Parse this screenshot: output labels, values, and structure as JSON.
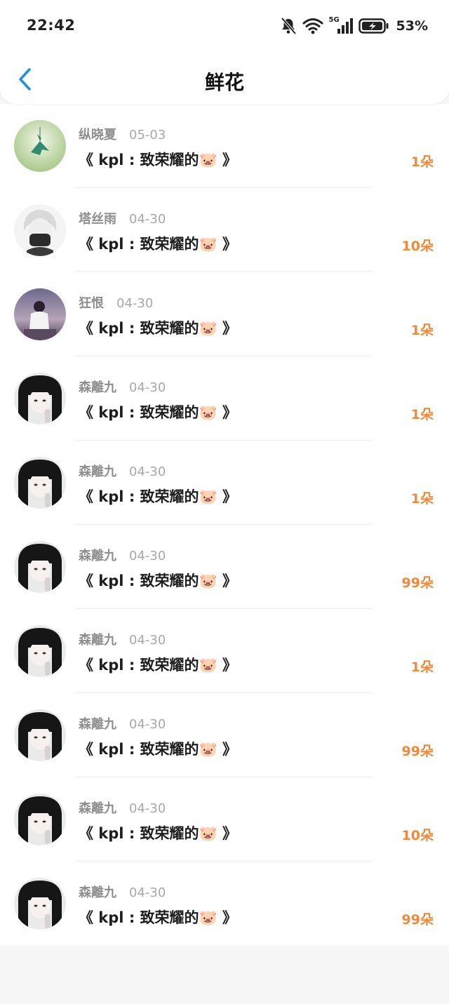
{
  "status_bar": {
    "time": "22:42",
    "battery": "53%",
    "network": "5G"
  },
  "header": {
    "title": "鲜花"
  },
  "colors": {
    "accent": "#1e90e0",
    "count": "#ee8a3a"
  },
  "rows": [
    {
      "name": "纵晓夏",
      "date": "05-03",
      "gift": "《 kpl : 致荣耀的🐷 》",
      "count": "1朵"
    },
    {
      "name": "塔丝雨",
      "date": "04-30",
      "gift": "《 kpl : 致荣耀的🐷 》",
      "count": "10朵"
    },
    {
      "name": "狂恨",
      "date": "04-30",
      "gift": "《 kpl : 致荣耀的🐷 》",
      "count": "1朵"
    },
    {
      "name": "森離九",
      "date": "04-30",
      "gift": "《 kpl : 致荣耀的🐷 》",
      "count": "1朵"
    },
    {
      "name": "森離九",
      "date": "04-30",
      "gift": "《 kpl : 致荣耀的🐷 》",
      "count": "1朵"
    },
    {
      "name": "森離九",
      "date": "04-30",
      "gift": "《 kpl : 致荣耀的🐷 》",
      "count": "99朵"
    },
    {
      "name": "森離九",
      "date": "04-30",
      "gift": "《 kpl : 致荣耀的🐷 》",
      "count": "1朵"
    },
    {
      "name": "森離九",
      "date": "04-30",
      "gift": "《 kpl : 致荣耀的🐷 》",
      "count": "99朵"
    },
    {
      "name": "森離九",
      "date": "04-30",
      "gift": "《 kpl : 致荣耀的🐷 》",
      "count": "10朵"
    },
    {
      "name": "森離九",
      "date": "04-30",
      "gift": "《 kpl : 致荣耀的🐷 》",
      "count": "99朵"
    }
  ]
}
